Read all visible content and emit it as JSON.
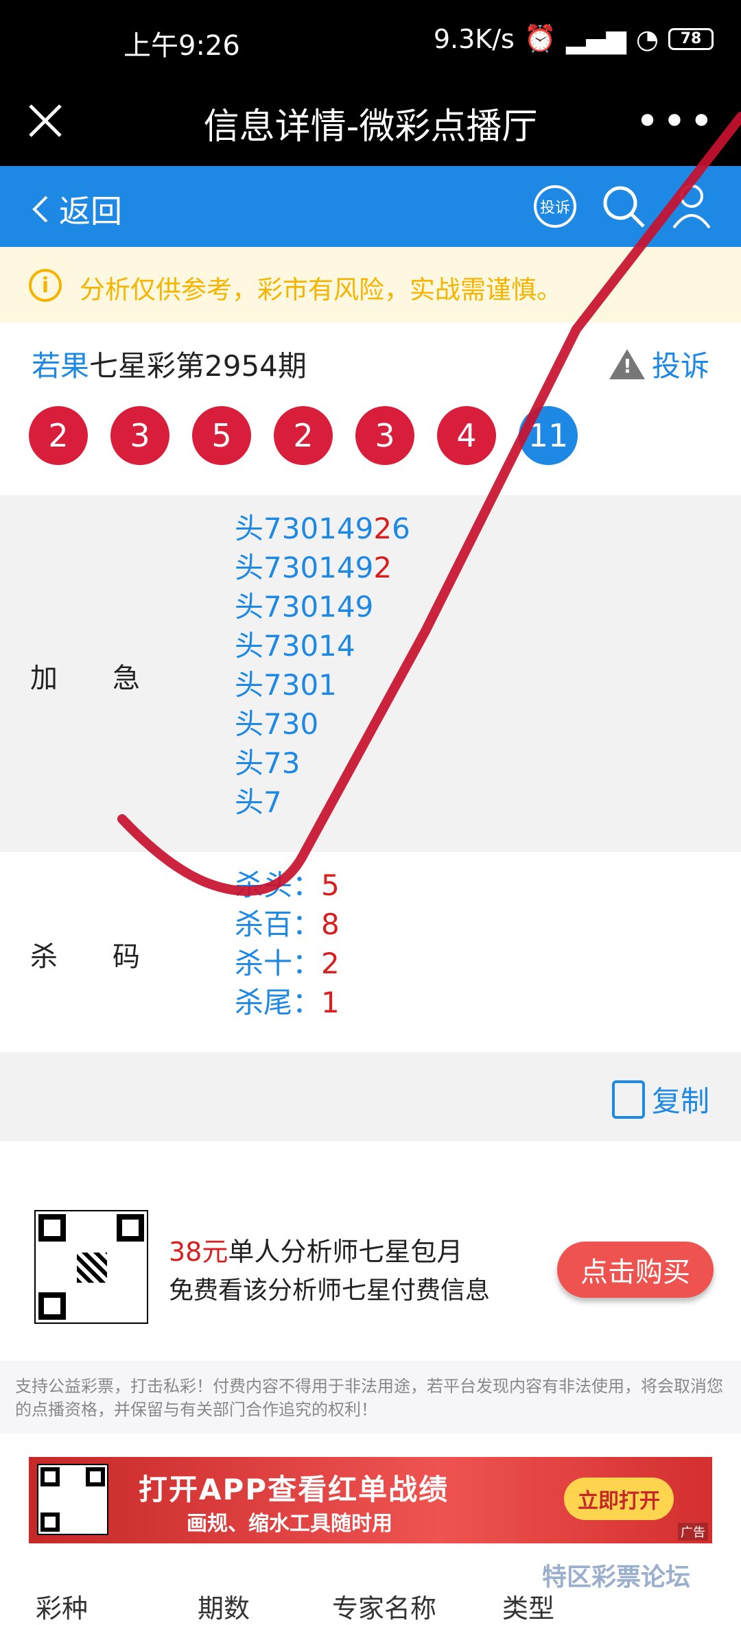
{
  "status_bar": {
    "time": "上午9:26",
    "speed": "9.3K/s",
    "battery": "78"
  },
  "title_bar": {
    "title": "信息详情-微彩点播厅",
    "more": "•••"
  },
  "nav": {
    "back_label": "返回",
    "complain_badge": "投诉"
  },
  "notice": {
    "icon": "i",
    "text": "分析仅供参考，彩市有风险，实战需谨慎。"
  },
  "heading": {
    "author": "若果",
    "title": "七星彩第2954期",
    "complain_label": "投诉"
  },
  "balls": [
    "2",
    "3",
    "5",
    "2",
    "3",
    "4",
    "11"
  ],
  "section_jiaji": {
    "label": "加急",
    "lines": [
      {
        "pre": "头73014",
        "mid": "9",
        "red": "2",
        "post": "6"
      },
      {
        "pre": "头730149",
        "mid": "",
        "red": "2",
        "post": ""
      },
      {
        "pre": "头730149",
        "mid": "",
        "red": "",
        "post": ""
      },
      {
        "pre": "头73014",
        "mid": "",
        "red": "",
        "post": ""
      },
      {
        "pre": "头7301",
        "mid": "",
        "red": "",
        "post": ""
      },
      {
        "pre": "头730",
        "mid": "",
        "red": "",
        "post": ""
      },
      {
        "pre": "头73",
        "mid": "",
        "red": "",
        "post": ""
      },
      {
        "pre": "头7",
        "mid": "",
        "red": "",
        "post": ""
      }
    ]
  },
  "section_shama": {
    "label": "杀码",
    "lines": [
      {
        "key": "杀头：",
        "val": "5"
      },
      {
        "key": "杀百：",
        "val": "8"
      },
      {
        "key": "杀十：",
        "val": "2"
      },
      {
        "key": "杀尾：",
        "val": "1"
      }
    ]
  },
  "copy_label": "复制",
  "offer": {
    "price": "38元",
    "line1_rest": "单人分析师七星包月",
    "line2": "免费看该分析师七星付费信息",
    "buy_label": "点击购买"
  },
  "disclaimer": "支持公益彩票，打击私彩！付费内容不得用于非法用途，若平台发现内容有非法使用，将会取消您的点播资格，并保留与有关部门合作追究的权利！",
  "banner": {
    "headline": "打开APP查看红单战绩",
    "subline": "画规、缩水工具随时用",
    "open_label": "立即打开",
    "ad_label": "广告"
  },
  "bottom_tabs": [
    "彩种",
    "期数",
    "专家名称",
    "类型"
  ],
  "watermark": "特区彩票论坛",
  "colors": {
    "blue": "#1e88e5",
    "red": "#d81e3a",
    "notice_yellow": "#f5b400",
    "annotation_red": "#c8102e"
  }
}
